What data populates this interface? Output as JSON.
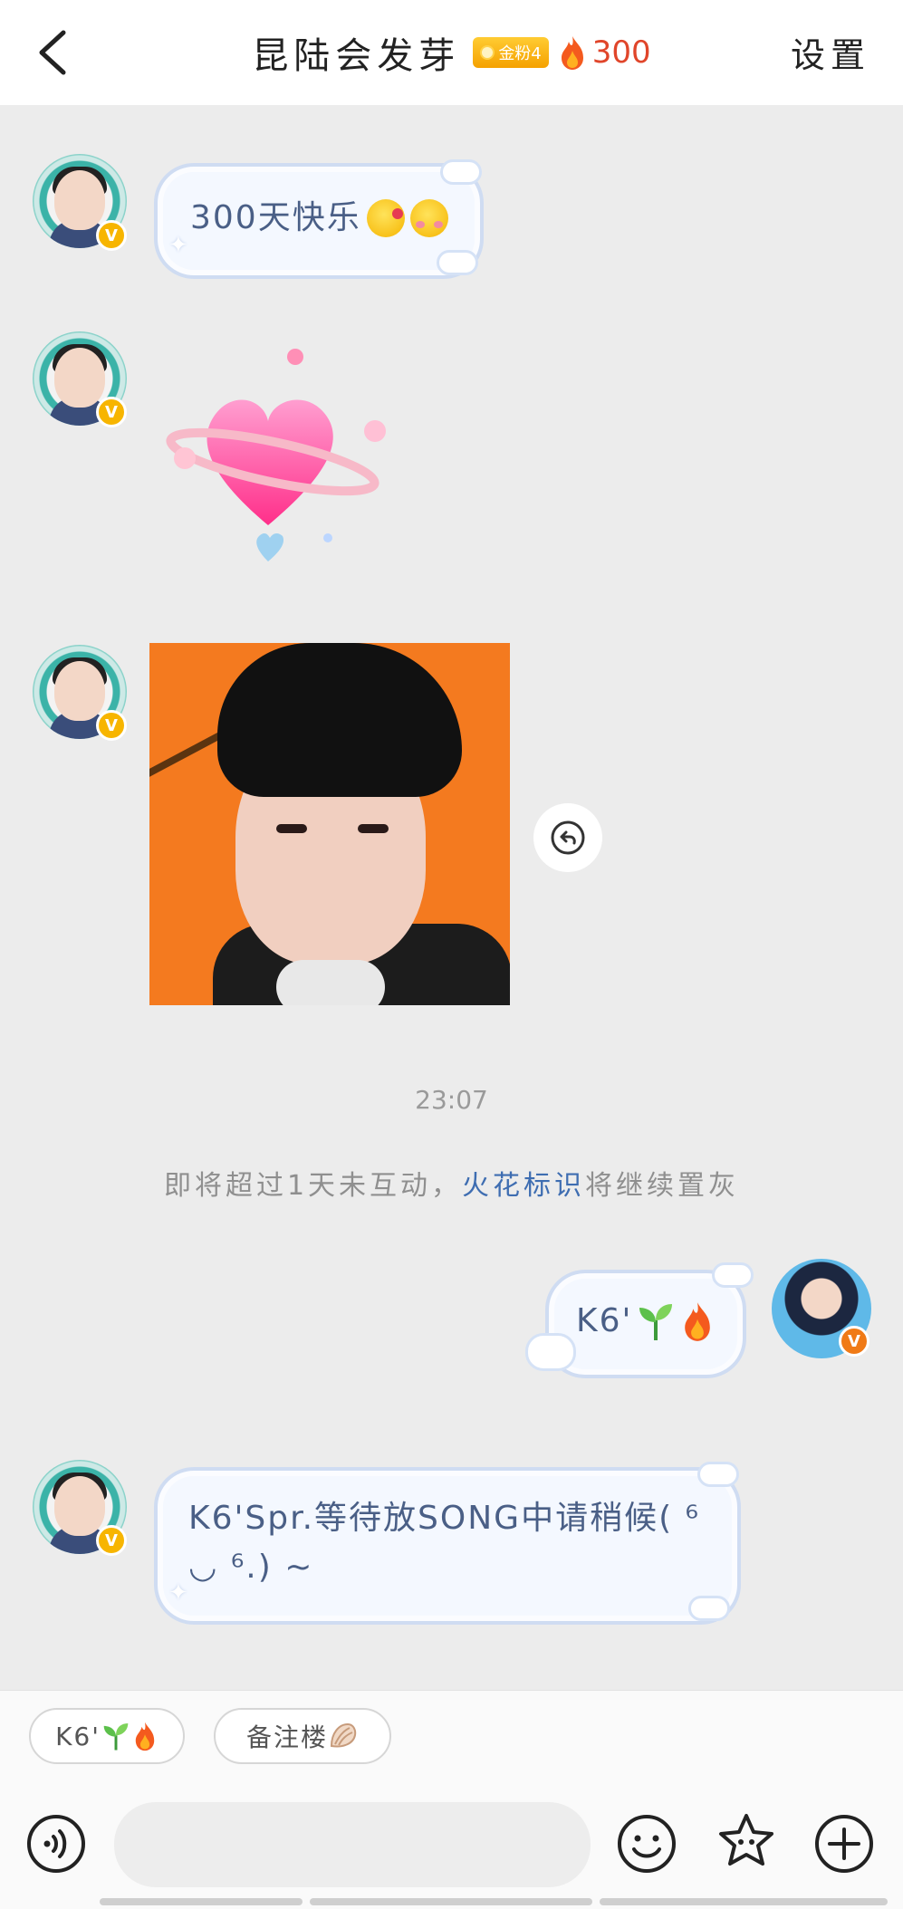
{
  "header": {
    "title": "昆陆会发芽",
    "badge_label": "金粉4",
    "fire_count": "300",
    "settings_label": "设置"
  },
  "messages": {
    "m1_text": "300天快乐",
    "time": "23:07",
    "notice_prefix": "即将超过1天未互动，",
    "notice_link": "火花标识",
    "notice_suffix": "将继续置灰",
    "m4_text": "K6'",
    "m5_line1": "K6'Spr.等待放SONG中请稍候(  ⁶",
    "m5_line2": "◡ ⁶.) ~"
  },
  "quick_replies": [
    {
      "label": "K6'"
    },
    {
      "label": "备注楼"
    }
  ],
  "input": {
    "placeholder": ""
  },
  "colors": {
    "accent": "#3e6db1",
    "fire": "#e0452a",
    "badge": "#f5a100"
  }
}
